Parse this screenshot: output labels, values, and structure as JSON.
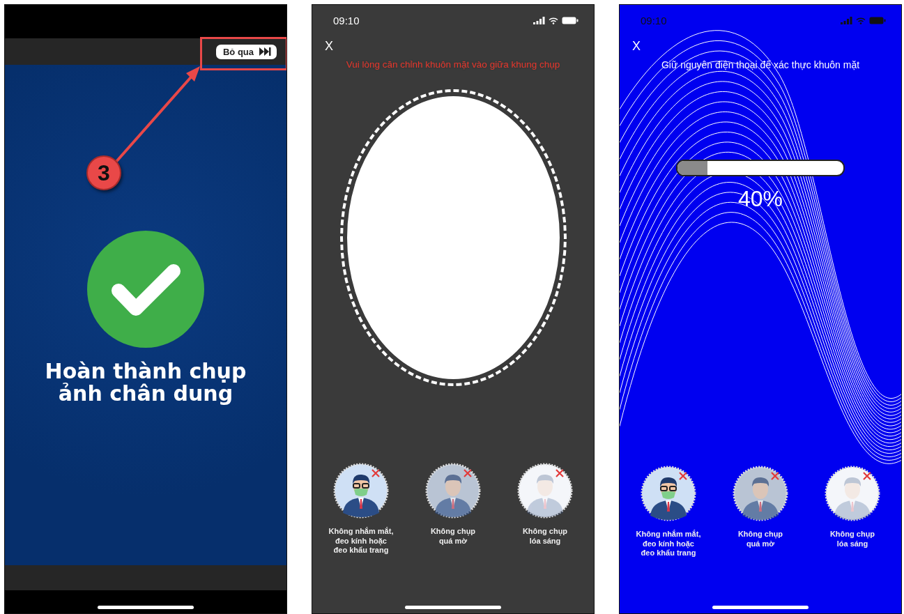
{
  "screens": [
    {
      "kind": "complete",
      "skip_button": {
        "label": "Bỏ qua"
      },
      "annotation": {
        "label": "3"
      },
      "title": "Hoàn thành chụp ảnh chân dung"
    },
    {
      "kind": "capture",
      "status_time": "09:10",
      "close": "X",
      "instruction": "Vui lòng căn chỉnh khuôn mặt vào giữa khung chụp",
      "tips": [
        {
          "kind": "mask",
          "label": "Không nhắm mắt, đeo kính hoặc đeo khẩu trang"
        },
        {
          "kind": "blur",
          "label": "Không chụp quá mờ"
        },
        {
          "kind": "glare",
          "label": "Không chụp lóa sáng"
        }
      ]
    },
    {
      "kind": "verify",
      "status_time": "09:10",
      "close": "X",
      "instruction": "Giữ nguyên điện thoại để xác thực khuôn mặt",
      "progress": {
        "level": 0.18,
        "reading": "40%"
      },
      "tips": [
        {
          "kind": "mask",
          "label": "Không nhắm mắt, đeo kính hoặc đeo khẩu trang"
        },
        {
          "kind": "blur",
          "label": "Không chụp quá mờ"
        },
        {
          "kind": "glare",
          "label": "Không chụp lóa sáng"
        }
      ]
    }
  ]
}
